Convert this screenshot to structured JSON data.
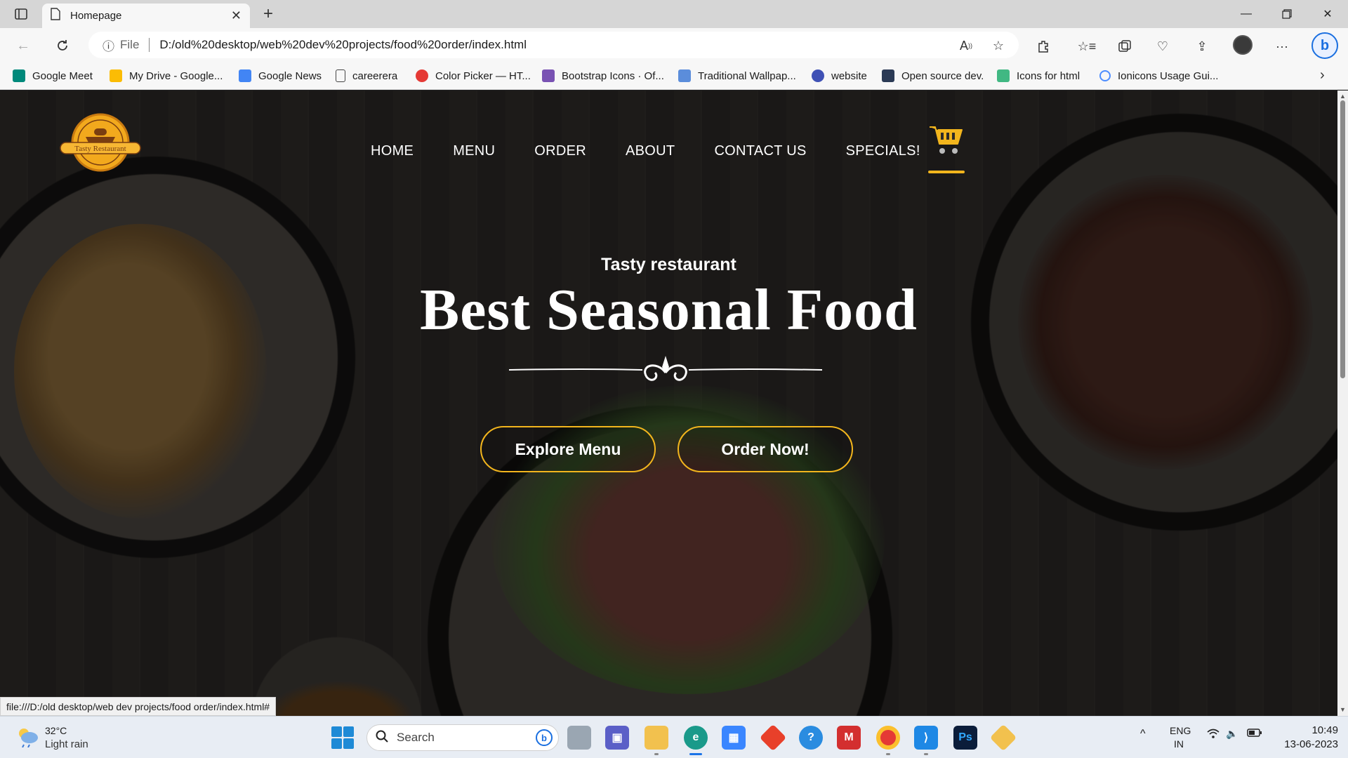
{
  "browser": {
    "tab_title": "Homepage",
    "url_prefix": "File",
    "url": "D:/old%20desktop/web%20dev%20projects/food%20order/index.html",
    "status_url": "file:///D:/old desktop/web dev projects/food order/index.html#"
  },
  "bookmarks": [
    {
      "label": "Google Meet",
      "icon": "google-meet-icon",
      "color": "#00897b"
    },
    {
      "label": "My Drive - Google...",
      "icon": "google-drive-icon",
      "color": "#fbbc04"
    },
    {
      "label": "Google News",
      "icon": "google-news-icon",
      "color": "#4285f4"
    },
    {
      "label": "careerera",
      "icon": "page-icon",
      "color": "#ffffff"
    },
    {
      "label": "Color Picker — HT...",
      "icon": "color-picker-icon",
      "color": "#e53935"
    },
    {
      "label": "Bootstrap Icons · Of...",
      "icon": "bootstrap-icon",
      "color": "#7952b3"
    },
    {
      "label": "Traditional Wallpap...",
      "icon": "wallpaper-icon",
      "color": "#5b8ddb"
    },
    {
      "label": "website",
      "icon": "gear-icon",
      "color": "#3f51b5"
    },
    {
      "label": "Open source dev.",
      "icon": "h-icon",
      "color": "#2b3a55"
    },
    {
      "label": "Icons for html",
      "icon": "vue-icon",
      "color": "#41b883"
    },
    {
      "label": "Ionicons Usage Gui...",
      "icon": "ionicons-icon",
      "color": "#4d8dff"
    }
  ],
  "site": {
    "logo_text": "Tasty Restaurant",
    "nav": [
      "HOME",
      "MENU",
      "ORDER",
      "ABOUT",
      "CONTACT US",
      "SPECIALS!"
    ],
    "hero_subtitle": "Tasty restaurant",
    "hero_title": "Best Seasonal Food",
    "buttons": {
      "explore": "Explore Menu",
      "order": "Order Now!"
    },
    "accent_color": "#f2b51d"
  },
  "taskbar": {
    "weather_temp": "32°C",
    "weather_desc": "Light rain",
    "search_placeholder": "Search",
    "lang_top": "ENG",
    "lang_bottom": "IN",
    "time": "10:49",
    "date": "13-06-2023"
  }
}
